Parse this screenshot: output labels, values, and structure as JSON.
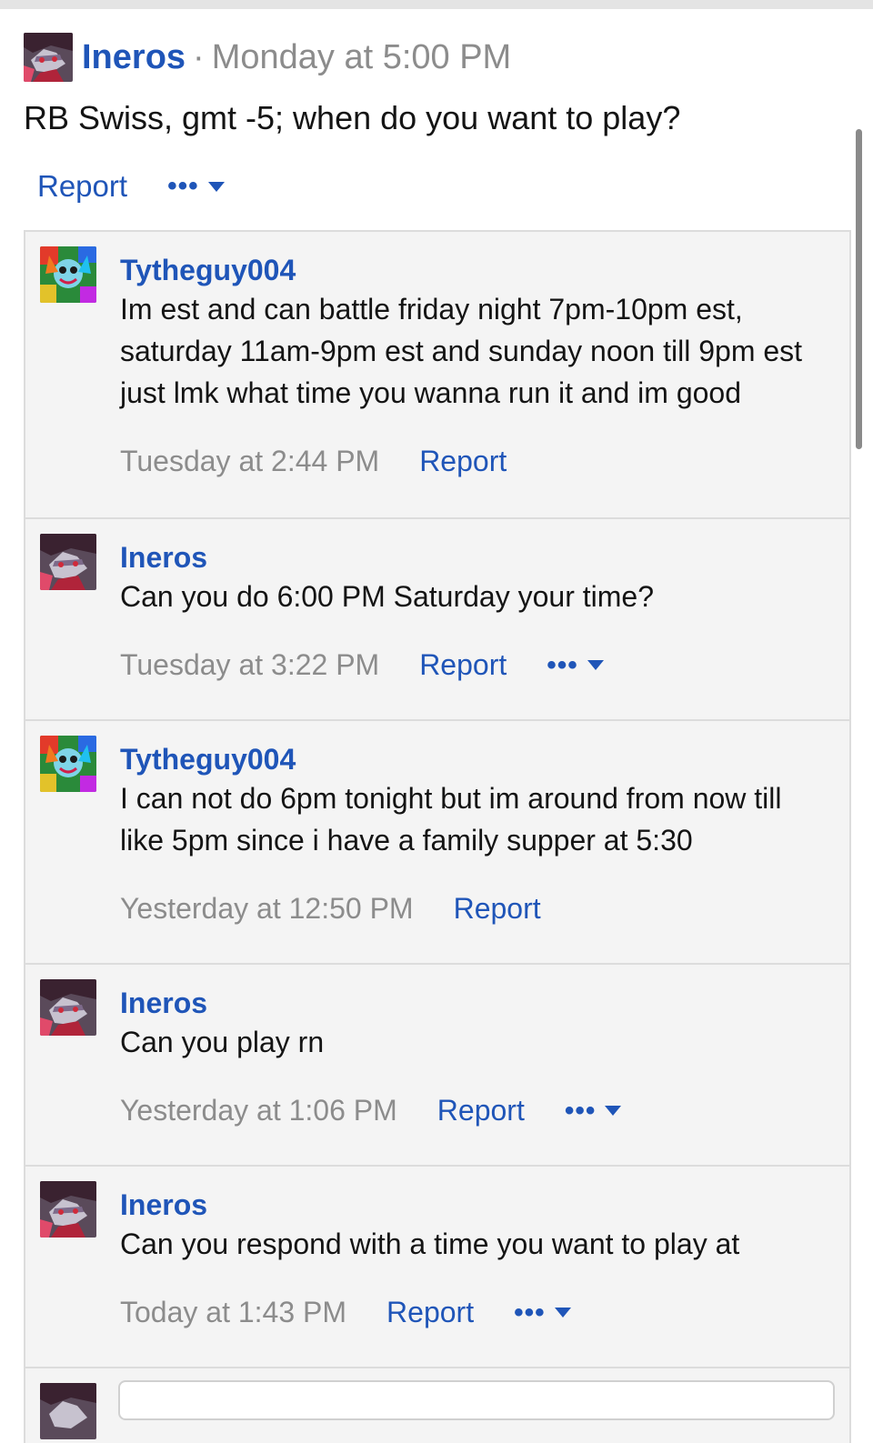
{
  "post": {
    "author": "Ineros",
    "separator": "·",
    "time": "Monday at 5:00 PM",
    "body": "RB Swiss, gmt -5; when do you want to play?",
    "report_label": "Report",
    "more_dots": "•••"
  },
  "comments": [
    {
      "author": "Tytheguy004",
      "text": "Im est and can battle friday night 7pm-10pm est, saturday 11am-9pm est and sunday noon till 9pm est just lmk what time you wanna run it and im good",
      "time": "Tuesday at 2:44 PM",
      "report_label": "Report"
    },
    {
      "author": "Ineros",
      "text": "Can you do 6:00 PM Saturday your time?",
      "time": "Tuesday at 3:22 PM",
      "report_label": "Report",
      "more_dots": "•••"
    },
    {
      "author": "Tytheguy004",
      "text": "I can not do 6pm tonight but im around from now till like 5pm since i have a family supper at 5:30",
      "time": "Yesterday at 12:50 PM",
      "report_label": "Report"
    },
    {
      "author": "Ineros",
      "text": "Can you play rn",
      "time": "Yesterday at 1:06 PM",
      "report_label": "Report",
      "more_dots": "•••"
    },
    {
      "author": "Ineros",
      "text": "Can you respond with a time you want to play at",
      "time": "Today at 1:43 PM",
      "report_label": "Report",
      "more_dots": "•••"
    }
  ],
  "colors": {
    "link": "#1f55b8",
    "muted": "#8c8c8c",
    "comment_bg": "#f4f4f4",
    "border": "#dcdcdc"
  },
  "icons": {
    "more_caret": "caret-down-icon",
    "avatar_ineros": "anime-character-avatar",
    "avatar_tytheguy": "colorful-creature-avatar"
  }
}
